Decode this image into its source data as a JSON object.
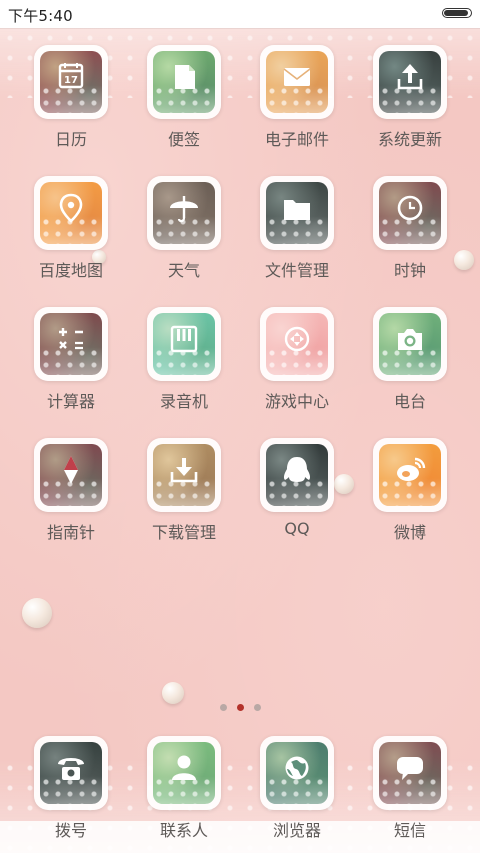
{
  "status": {
    "time": "下午5:40",
    "battery_percent": 100
  },
  "apps": [
    {
      "label": "日历",
      "icon": "calendar-icon",
      "colors": [
        "#8d4f52",
        "#c1a283",
        "#6e7167"
      ]
    },
    {
      "label": "便签",
      "icon": "note-icon",
      "colors": [
        "#6ca86e",
        "#b5d9a4",
        "#5d9069"
      ]
    },
    {
      "label": "电子邮件",
      "icon": "mail-icon",
      "colors": [
        "#e9a457",
        "#f1cfa0",
        "#db9555"
      ]
    },
    {
      "label": "系统更新",
      "icon": "update-icon",
      "colors": [
        "#38403f",
        "#738884",
        "#4e5b59"
      ]
    },
    {
      "label": "百度地图",
      "icon": "map-pin-icon",
      "colors": [
        "#f39b44",
        "#f6c38a",
        "#e58a44"
      ]
    },
    {
      "label": "天气",
      "icon": "umbrella-icon",
      "colors": [
        "#6c5f56",
        "#a8988a",
        "#7b6d62"
      ]
    },
    {
      "label": "文件管理",
      "icon": "folder-icon",
      "colors": [
        "#3e4745",
        "#788682",
        "#5b6462"
      ]
    },
    {
      "label": "时钟",
      "icon": "clock-icon",
      "colors": [
        "#7f4b4f",
        "#b29b86",
        "#6d6b62"
      ]
    },
    {
      "label": "计算器",
      "icon": "calculator-icon",
      "colors": [
        "#7e4b4d",
        "#b19b87",
        "#707166"
      ]
    },
    {
      "label": "录音机",
      "icon": "recorder-icon",
      "colors": [
        "#6bc3a5",
        "#b9ddc2",
        "#60b08d"
      ]
    },
    {
      "label": "游戏中心",
      "icon": "gamepad-icon",
      "colors": [
        "#f5b7b6",
        "#f9d4d1",
        "#f0a3a3"
      ]
    },
    {
      "label": "电台",
      "icon": "radio-icon",
      "colors": [
        "#6faf7a",
        "#b4d8a6",
        "#5b9c74"
      ]
    },
    {
      "label": "指南针",
      "icon": "compass-icon",
      "colors": [
        "#7f4a50",
        "#b09c87",
        "#6b6a60"
      ]
    },
    {
      "label": "下载管理",
      "icon": "download-icon",
      "colors": [
        "#ae8c61",
        "#e0c69b",
        "#9f7c58"
      ]
    },
    {
      "label": "QQ",
      "icon": "qq-penguin-icon",
      "colors": [
        "#333b3b",
        "#7a8784",
        "#4d5756"
      ]
    },
    {
      "label": "微博",
      "icon": "weibo-icon",
      "colors": [
        "#f39c3d",
        "#f7c98b",
        "#f08b37"
      ]
    }
  ],
  "dock": [
    {
      "label": "拨号",
      "icon": "phone-icon",
      "colors": [
        "#374240",
        "#76827f",
        "#505957"
      ]
    },
    {
      "label": "联系人",
      "icon": "contacts-icon",
      "colors": [
        "#7bbb7e",
        "#c3ddb1",
        "#6fab77"
      ]
    },
    {
      "label": "浏览器",
      "icon": "browser-icon",
      "colors": [
        "#4d7d6e",
        "#a6c4a2",
        "#5a8d73"
      ]
    },
    {
      "label": "短信",
      "icon": "message-icon",
      "colors": [
        "#7f4d52",
        "#b49d89",
        "#6c695f"
      ]
    }
  ],
  "pagination": {
    "total_pages": 3,
    "active_page": 2
  }
}
